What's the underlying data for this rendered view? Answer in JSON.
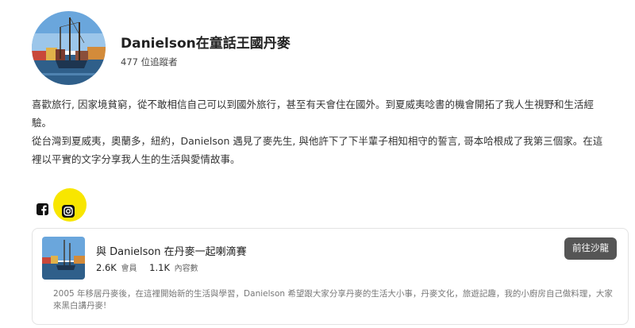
{
  "profile": {
    "name": "Danielson在童話王國丹麥",
    "followers": "477 位追蹤者"
  },
  "bio": {
    "paragraph1": "喜歡旅行, 因家境貧窮，從不敢相信自己可以到國外旅行，甚至有天會住在國外。到夏威夷唸書的機會開拓了我人生視野和生活經驗。",
    "paragraph2": "從台灣到夏威夷，奧蘭多，紐約，Danielson 遇見了麥先生, 與他許下了下半輩子相知相守的誓言, 哥本哈根成了我第三個家。在這裡以平實的文字分享我人生的生活與愛情故事。"
  },
  "social": {
    "facebook_icon": "facebook-icon",
    "instagram_icon": "instagram-icon",
    "highlight_color": "#f8e600"
  },
  "salon_card": {
    "title": "與 Danielson 在丹麥一起喇滴賽",
    "members_count": "2.6K",
    "members_label": "會員",
    "content_count": "1.1K",
    "content_label": "內容數",
    "button_label": "前往沙龍",
    "description": "2005 年移居丹麥後，在這裡開始新的生活與學習，Danielson 希望跟大家分享丹麥的生活大小事，丹麥文化，旅遊記趣，我的小廚房自己做料理，大家來黑白講丹麥!"
  }
}
